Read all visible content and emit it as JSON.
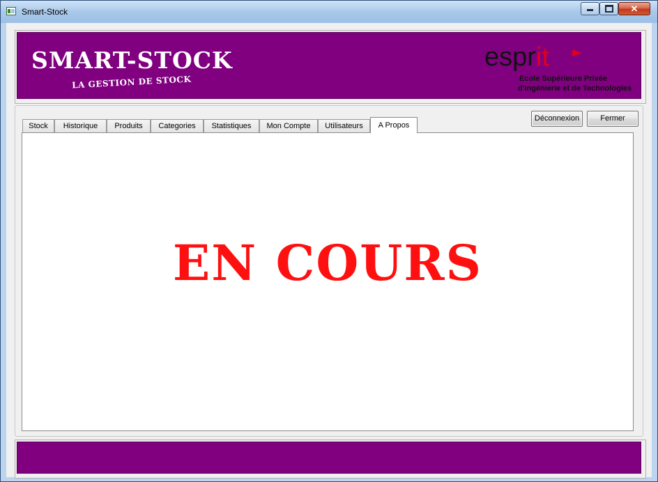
{
  "window": {
    "title": "Smart-Stock",
    "close_label": "✕"
  },
  "header": {
    "logo_title": "SMART-STOCK",
    "logo_subtitle": "LA GESTION DE STOCK",
    "partner_prefix": "espr",
    "partner_suffix": "it",
    "partner_line1": "Ecole Supérieure Privée",
    "partner_line2": "d'Ingénierie et de Technologies",
    "brand_color": "#800080",
    "partner_accent": "#e0001a"
  },
  "tabs": [
    {
      "label": "Stock",
      "active": false
    },
    {
      "label": "Historique",
      "active": false
    },
    {
      "label": "Produits",
      "active": false
    },
    {
      "label": "Categories",
      "active": false
    },
    {
      "label": "Statistiques",
      "active": false
    },
    {
      "label": "Mon Compte",
      "active": false
    },
    {
      "label": "Utilisateurs",
      "active": false
    },
    {
      "label": "A Propos",
      "active": true
    }
  ],
  "actions": {
    "logout_label": "Déconnexion",
    "close_label": "Fermer"
  },
  "content": {
    "status_text": "EN COURS",
    "status_color": "#ff1010"
  }
}
